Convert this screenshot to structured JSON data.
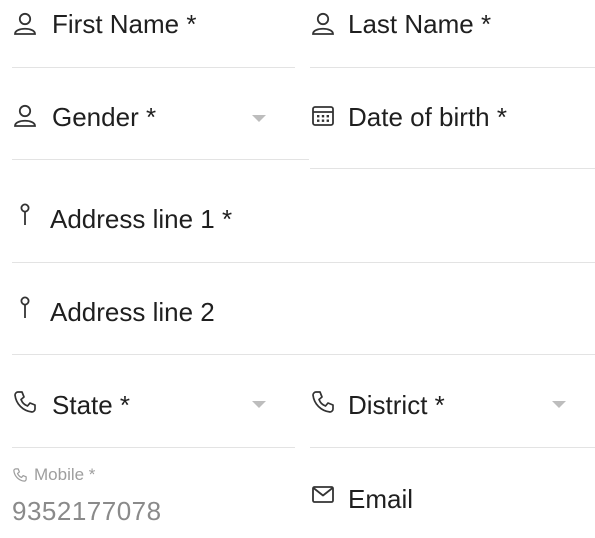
{
  "form": {
    "first_name": {
      "label": "First Name *",
      "icon": "person-icon"
    },
    "last_name": {
      "label": "Last Name *",
      "icon": "person-icon"
    },
    "gender": {
      "label": "Gender *",
      "icon": "person-icon"
    },
    "date_of_birth": {
      "label": "Date of birth *",
      "icon": "calendar-icon"
    },
    "address_line_1": {
      "label": "Address line 1 *",
      "icon": "pin-icon"
    },
    "address_line_2": {
      "label": "Address line 2",
      "icon": "pin-icon"
    },
    "state": {
      "label": "State *",
      "icon": "phone-icon"
    },
    "district": {
      "label": "District *",
      "icon": "phone-icon"
    },
    "mobile": {
      "label": "Mobile *",
      "value": "9352177078",
      "icon": "phone-icon"
    },
    "email": {
      "label": "Email",
      "icon": "mail-icon"
    }
  },
  "colors": {
    "divider": "#e3e3e3",
    "text": "#1f1f1f",
    "muted": "#9e9e9e",
    "caret": "#bdbdbd"
  }
}
